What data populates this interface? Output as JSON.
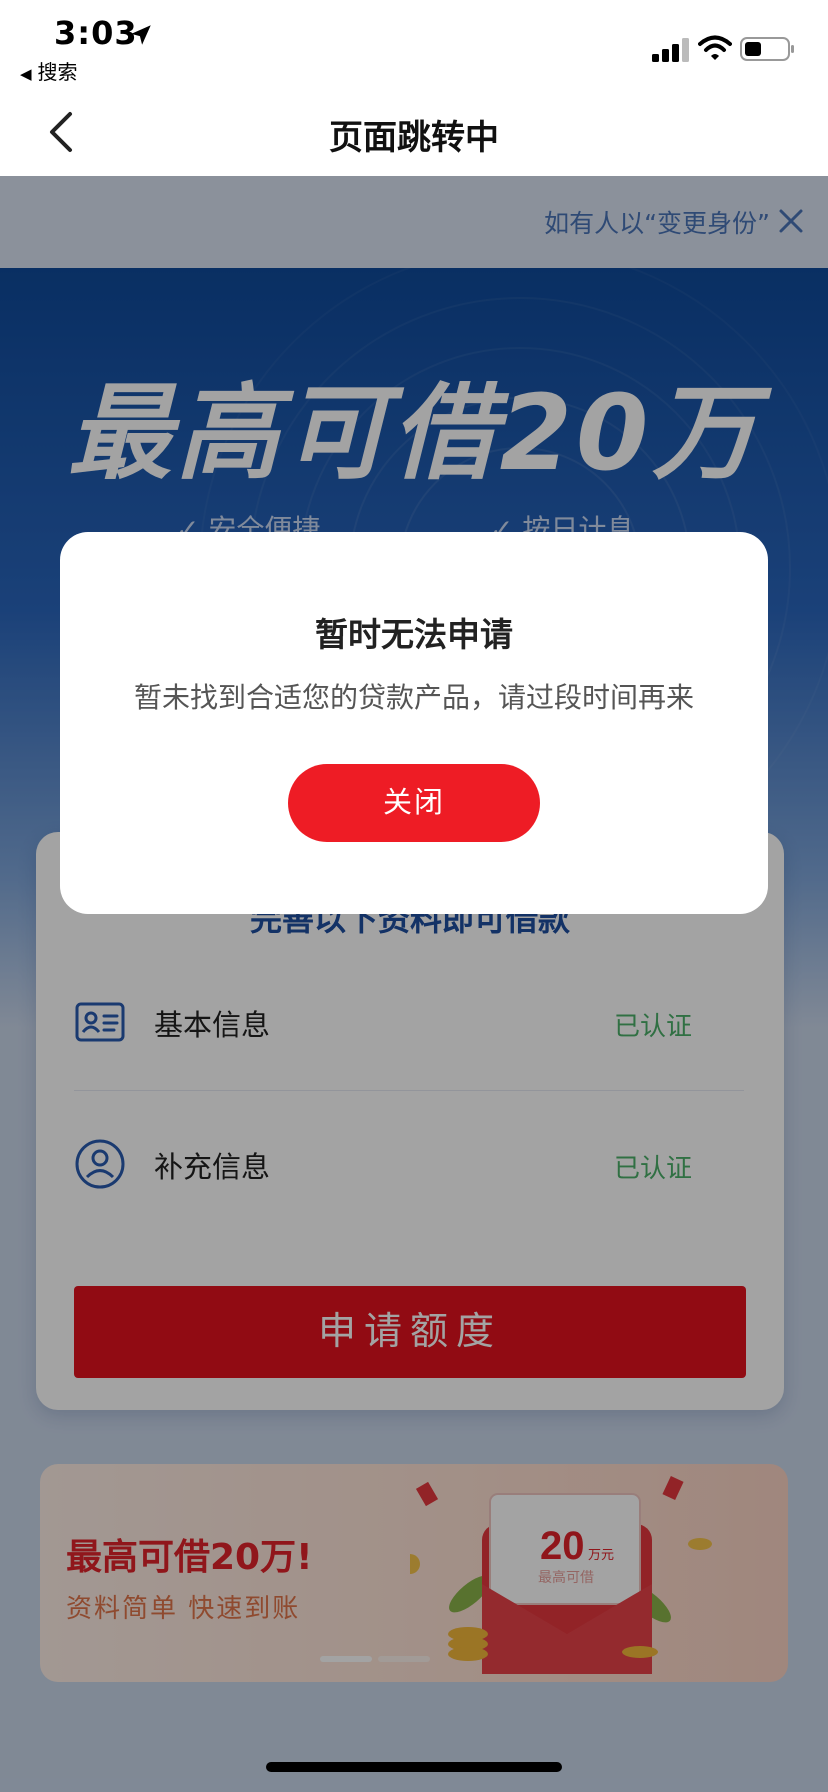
{
  "status_bar": {
    "time": "3:03",
    "back_app_label": "搜索",
    "icons": [
      "location-arrow-icon",
      "signal-icon",
      "wifi-icon",
      "battery-icon"
    ]
  },
  "nav": {
    "title": "页面跳转中",
    "back_icon": "chevron-left-icon"
  },
  "notice": {
    "text": "如有人以“变更身份”",
    "close_icon": "close-icon"
  },
  "hero": {
    "title": "最高可借20万",
    "features": [
      "✓ 安全便捷",
      "✓ 按日计息"
    ]
  },
  "form_card": {
    "title": "完善以下资料即可借款",
    "rows": [
      {
        "icon": "id-card-icon",
        "label": "基本信息",
        "status": "已认证"
      },
      {
        "icon": "user-circle-icon",
        "label": "补充信息",
        "status": "已认证"
      }
    ],
    "apply_button": "申请额度"
  },
  "banner": {
    "title": "最高可借20万!",
    "subtitle": "资料简单 快速到账",
    "envelope_amount": "20",
    "envelope_unit": "万元",
    "envelope_caption": "最高可借",
    "carousel_active_index": 0,
    "carousel_count": 2
  },
  "dialog": {
    "title": "暂时无法申请",
    "message": "暂未找到合适您的贷款产品，请过段时间再来",
    "close_button": "关闭"
  },
  "colors": {
    "primary_red": "#ee1c25",
    "hero_blue": "#0f4a9b",
    "verified_green": "#4caf6a",
    "notice_blue": "#4a74b8"
  }
}
